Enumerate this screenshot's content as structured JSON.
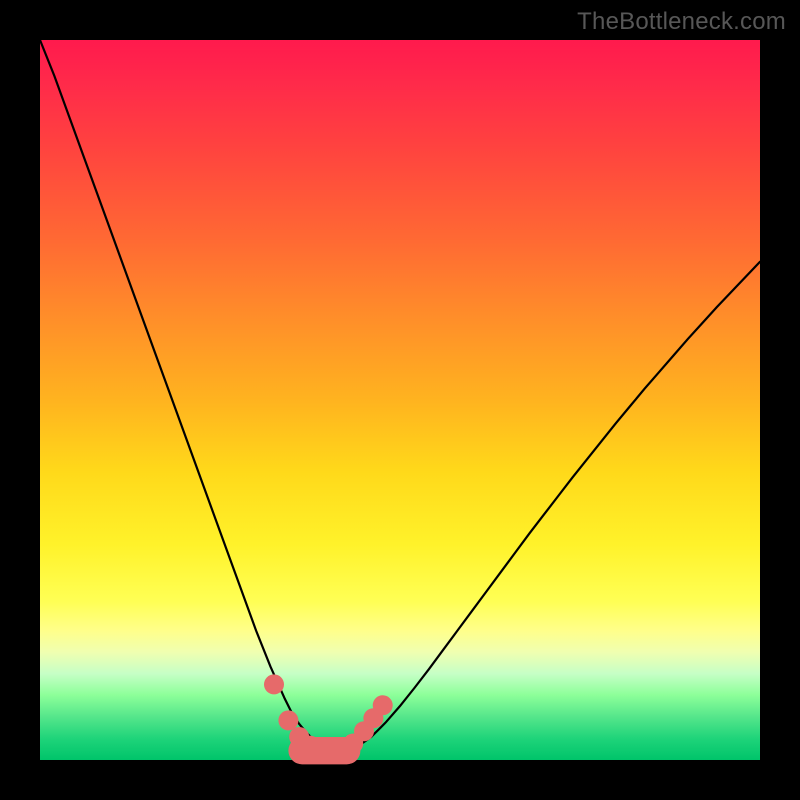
{
  "watermark": "TheBottleneck.com",
  "colors": {
    "frame": "#000000",
    "curve_stroke": "#000000",
    "marker_fill": "#e66a6a",
    "gradient_stops": [
      "#ff1a4d",
      "#ff2a4a",
      "#ff4040",
      "#ff6a33",
      "#ff8c2a",
      "#ffb31f",
      "#ffd91a",
      "#fff22a",
      "#ffff55",
      "#ffff8a",
      "#f0ffb0",
      "#c6ffc6",
      "#8cff99",
      "#55e68b",
      "#1fd47a",
      "#00c46a"
    ]
  },
  "chart_data": {
    "type": "line",
    "title": "",
    "xlabel": "",
    "ylabel": "",
    "xlim": [
      0,
      100
    ],
    "ylim": [
      0,
      100
    ],
    "grid": false,
    "legend": null,
    "x": [
      0,
      2,
      4,
      6,
      8,
      10,
      12,
      14,
      16,
      18,
      20,
      22,
      24,
      26,
      28,
      30,
      32,
      34,
      35,
      36,
      37,
      38,
      39,
      40,
      41,
      42,
      43,
      44,
      46,
      48,
      50,
      52,
      54,
      56,
      58,
      60,
      62,
      64,
      66,
      68,
      70,
      72,
      74,
      76,
      78,
      80,
      82,
      84,
      86,
      88,
      90,
      92,
      94,
      96,
      98,
      100
    ],
    "values": [
      100,
      95,
      89.5,
      84,
      78.5,
      73,
      67.5,
      62,
      56.5,
      51,
      45.5,
      40,
      34.5,
      29,
      23.5,
      18,
      13,
      8.5,
      6.5,
      5,
      3.8,
      2.8,
      2,
      1.4,
      1,
      1,
      1.2,
      1.8,
      3.2,
      5.2,
      7.5,
      10,
      12.6,
      15.3,
      18,
      20.7,
      23.4,
      26.1,
      28.8,
      31.5,
      34.1,
      36.7,
      39.3,
      41.8,
      44.3,
      46.8,
      49.2,
      51.6,
      53.9,
      56.2,
      58.5,
      60.7,
      62.9,
      65,
      67.1,
      69.2
    ],
    "notes": "V-shaped bottleneck curve; y is mismatch percentage (0 = ideal green, 100 = severe red); minimum around x≈41.",
    "markers": {
      "shape": "circle",
      "xy": [
        [
          32.5,
          10.5
        ],
        [
          34.5,
          5.5
        ],
        [
          36.0,
          3.2
        ],
        [
          37.5,
          2.0
        ],
        [
          39.0,
          1.3
        ],
        [
          40.5,
          1.0
        ],
        [
          42.0,
          1.2
        ],
        [
          43.5,
          2.3
        ],
        [
          45.0,
          4.0
        ],
        [
          46.3,
          5.8
        ],
        [
          47.6,
          7.6
        ]
      ],
      "pill": {
        "x0": 34.5,
        "x1": 44.5,
        "y": 1.3,
        "thickness": 3.8
      }
    }
  }
}
